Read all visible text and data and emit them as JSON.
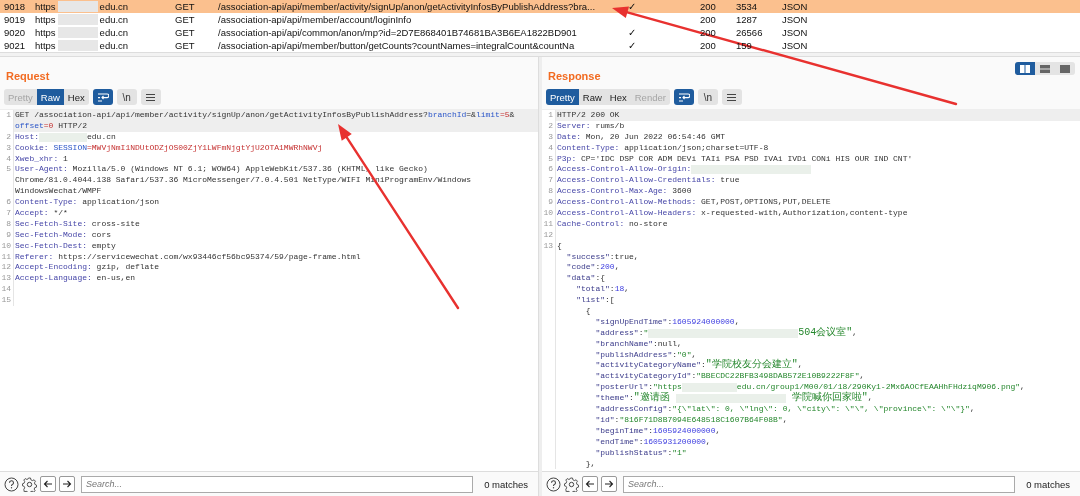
{
  "history": {
    "rows": [
      {
        "number": "9018",
        "scheme": "https",
        "domain": "edu.cn",
        "method": "GET",
        "url": "/association-api/api/member/activity/signUp/anon/getActivityInfosByPublishAddress?bra...",
        "column_5": "✓",
        "status": "200",
        "length": "3534",
        "mime": "JSON",
        "selected": true
      },
      {
        "number": "9019",
        "scheme": "https",
        "domain": "edu.cn",
        "method": "GET",
        "url": "/association-api/api/member/account/loginInfo",
        "status": "200",
        "length": "1287",
        "mime": "JSON",
        "selected": false
      },
      {
        "number": "9020",
        "scheme": "https",
        "domain": "edu.cn",
        "method": "GET",
        "url": "/association-api/api/common/anon/mp?id=2D7E868401B74681BA3B6EA1822BD901",
        "column_5": "✓",
        "status": "200",
        "length": "26566",
        "mime": "JSON",
        "selected": false
      },
      {
        "number": "9021",
        "scheme": "https",
        "domain": "edu.cn",
        "method": "GET",
        "url": "/association-api/api/member/button/getCounts?countNames=integralCount&countNa",
        "column_5": "✓",
        "status": "200",
        "length": "159",
        "mime": "JSON",
        "selected": false
      }
    ]
  },
  "layout_toggle": [
    {
      "selected": true
    },
    {
      "selected": false
    },
    {
      "selected": false
    }
  ],
  "panes": [
    {
      "title": "Request",
      "view_tabs": [
        {
          "label": "Pretty",
          "selected": false,
          "disabled": true
        },
        {
          "label": "Raw",
          "selected": true,
          "disabled": false
        },
        {
          "label": "Hex",
          "selected": false,
          "disabled": false
        }
      ],
      "wrap_lines": {
        "on": true
      },
      "newline_button": "\\n",
      "lines": [
        {
          "n": "1",
          "highlighted": true,
          "segs": [
            {
              "kind": "plain",
              "text": "GET /association-api/api/member/activity/signUp/anon/getActivityInfosByPublishAddress?"
            },
            {
              "kind": "param",
              "text": "branchId"
            },
            {
              "kind": "plain",
              "text": "=&"
            },
            {
              "kind": "param",
              "text": "limit"
            },
            {
              "kind": "pval",
              "text": "=5"
            },
            {
              "kind": "plain",
              "text": "&"
            }
          ]
        },
        {
          "highlighted": true,
          "segs": [
            {
              "kind": "param",
              "text": "offset"
            },
            {
              "kind": "pval",
              "text": "=0"
            },
            {
              "kind": "plain",
              "text": " HTTP/2"
            }
          ]
        },
        {
          "n": "2",
          "highlighted": false,
          "segs": [
            {
              "kind": "name",
              "text": "Host:"
            },
            {
              "kind": "blur"
            },
            {
              "kind": "plain",
              "text": "edu.cn"
            }
          ]
        },
        {
          "n": "3",
          "highlighted": false,
          "segs": [
            {
              "kind": "name",
              "text": "Cookie:"
            },
            {
              "kind": "param",
              "text": " SESSION"
            },
            {
              "kind": "pval",
              "text": "=MWVjNmI1NDUtODZjOS00ZjY1LWFmNjgtYjU2OTA1MWRhNWVj"
            }
          ]
        },
        {
          "n": "4",
          "highlighted": false,
          "segs": [
            {
              "kind": "name",
              "text": "Xweb_xhr:"
            },
            {
              "kind": "plain",
              "text": " 1"
            }
          ]
        },
        {
          "n": "5",
          "highlighted": false,
          "segs": [
            {
              "kind": "name",
              "text": "User-Agent:"
            },
            {
              "kind": "plain",
              "text": " Mozilla/5.0 (Windows NT 6.1; WOW64) AppleWebKit/537.36 (KHTML, like Gecko)"
            }
          ]
        },
        {
          "highlighted": false,
          "segs": [
            {
              "kind": "plain",
              "text": "Chrome/81.0.4044.138 Safari/537.36 MicroMessenger/7.0.4.501 NetType/WIFI MiniProgramEnv/Windows"
            }
          ]
        },
        {
          "highlighted": false,
          "segs": [
            {
              "kind": "plain",
              "text": "WindowsWechat/WMPF"
            }
          ]
        },
        {
          "n": "6",
          "highlighted": false,
          "segs": [
            {
              "kind": "name",
              "text": "Content-Type:"
            },
            {
              "kind": "plain",
              "text": " application/json"
            }
          ]
        },
        {
          "n": "7",
          "highlighted": false,
          "segs": [
            {
              "kind": "name",
              "text": "Accept:"
            },
            {
              "kind": "plain",
              "text": " */*"
            }
          ]
        },
        {
          "n": "8",
          "highlighted": false,
          "segs": [
            {
              "kind": "name",
              "text": "Sec-Fetch-Site:"
            },
            {
              "kind": "plain",
              "text": " cross-site"
            }
          ]
        },
        {
          "n": "9",
          "highlighted": false,
          "segs": [
            {
              "kind": "name",
              "text": "Sec-Fetch-Mode:"
            },
            {
              "kind": "plain",
              "text": " cors"
            }
          ]
        },
        {
          "n": "10",
          "highlighted": false,
          "segs": [
            {
              "kind": "name",
              "text": "Sec-Fetch-Dest:"
            },
            {
              "kind": "plain",
              "text": " empty"
            }
          ]
        },
        {
          "n": "11",
          "highlighted": false,
          "segs": [
            {
              "kind": "name",
              "text": "Referer:"
            },
            {
              "kind": "plain",
              "text": " https://servicewechat.com/wx93446cf56bc95374/59/page-frame.html"
            }
          ]
        },
        {
          "n": "12",
          "highlighted": false,
          "segs": [
            {
              "kind": "name",
              "text": "Accept-Encoding:"
            },
            {
              "kind": "plain",
              "text": " gzip, deflate"
            }
          ]
        },
        {
          "n": "13",
          "highlighted": false,
          "segs": [
            {
              "kind": "name",
              "text": "Accept-Language:"
            },
            {
              "kind": "plain",
              "text": " en-us,en"
            }
          ]
        },
        {
          "n": "14",
          "highlighted": false
        },
        {
          "n": "15",
          "highlighted": false
        }
      ],
      "search": {
        "placeholder": "Search...",
        "matches": "0 matches"
      }
    },
    {
      "title": "Response",
      "view_tabs": [
        {
          "label": "Pretty",
          "selected": true,
          "disabled": false
        },
        {
          "label": "Raw",
          "selected": false,
          "disabled": false
        },
        {
          "label": "Hex",
          "selected": false,
          "disabled": false
        },
        {
          "label": "Render",
          "selected": false,
          "disabled": true
        }
      ],
      "wrap_lines": {
        "on": true
      },
      "newline_button": "\\n",
      "lines": [
        {
          "n": "1",
          "highlighted": true,
          "segs": [
            {
              "kind": "plain",
              "text": "HTTP/2 200 OK"
            }
          ]
        },
        {
          "n": "2",
          "highlighted": false,
          "segs": [
            {
              "kind": "name",
              "text": "Server:"
            },
            {
              "kind": "plain",
              "text": " rums/b"
            }
          ]
        },
        {
          "n": "3",
          "highlighted": false,
          "segs": [
            {
              "kind": "name",
              "text": "Date:"
            },
            {
              "kind": "plain",
              "text": " Mon, 20 Jun 2022 06:54:46 GMT"
            }
          ]
        },
        {
          "n": "4",
          "highlighted": false,
          "segs": [
            {
              "kind": "name",
              "text": "Content-Type:"
            },
            {
              "kind": "plain",
              "text": " application/json;charset=UTF-8"
            }
          ]
        },
        {
          "n": "5",
          "highlighted": false,
          "segs": [
            {
              "kind": "name",
              "text": "P3p:"
            },
            {
              "kind": "plain",
              "text": " CP='IDC DSP COR ADM DEVi TAIi PSA PSD IVAi IVDi CONi HIS OUR IND CNT'"
            }
          ]
        },
        {
          "n": "6",
          "highlighted": false,
          "segs": [
            {
              "kind": "name",
              "text": "Access-Control-Allow-Origin:"
            },
            {
              "kind": "blur"
            }
          ]
        },
        {
          "n": "7",
          "highlighted": false,
          "segs": [
            {
              "kind": "name",
              "text": "Access-Control-Allow-Credentials:"
            },
            {
              "kind": "plain",
              "text": " true"
            }
          ]
        },
        {
          "n": "8",
          "highlighted": false,
          "segs": [
            {
              "kind": "name",
              "text": "Access-Control-Max-Age:"
            },
            {
              "kind": "plain",
              "text": " 3600"
            }
          ]
        },
        {
          "n": "9",
          "highlighted": false,
          "segs": [
            {
              "kind": "name",
              "text": "Access-Control-Allow-Methods:"
            },
            {
              "kind": "plain",
              "text": " GET,POST,OPTIONS,PUT,DELETE"
            }
          ]
        },
        {
          "n": "10",
          "highlighted": false,
          "segs": [
            {
              "kind": "name",
              "text": "Access-Control-Allow-Headers:"
            },
            {
              "kind": "plain",
              "text": " x-requested-with,Authorization,content-type"
            }
          ]
        },
        {
          "n": "11",
          "highlighted": false,
          "segs": [
            {
              "kind": "name",
              "text": "Cache-Control:"
            },
            {
              "kind": "plain",
              "text": " no-store"
            }
          ]
        },
        {
          "n": "12",
          "highlighted": false
        },
        {
          "n": "13",
          "highlighted": false,
          "segs": [
            {
              "kind": "plain",
              "text": "{"
            }
          ]
        },
        {
          "highlighted": false,
          "segs": [
            {
              "kind": "key",
              "text": "  \"success\""
            },
            {
              "kind": "plain",
              "text": ":true,"
            }
          ]
        },
        {
          "highlighted": false,
          "segs": [
            {
              "kind": "key",
              "text": "  \"code\""
            },
            {
              "kind": "plain",
              "text": ":"
            },
            {
              "kind": "num",
              "text": "200"
            },
            {
              "kind": "plain",
              "text": ","
            }
          ]
        },
        {
          "highlighted": false,
          "segs": [
            {
              "kind": "key",
              "text": "  \"data\""
            },
            {
              "kind": "plain",
              "text": ":{"
            }
          ]
        },
        {
          "highlighted": false,
          "segs": [
            {
              "kind": "key",
              "text": "    \"total\""
            },
            {
              "kind": "plain",
              "text": ":"
            },
            {
              "kind": "num",
              "text": "18"
            },
            {
              "kind": "plain",
              "text": ","
            }
          ]
        },
        {
          "highlighted": false,
          "segs": [
            {
              "kind": "key",
              "text": "    \"list\""
            },
            {
              "kind": "plain",
              "text": ":["
            }
          ]
        },
        {
          "highlighted": false,
          "segs": [
            {
              "kind": "plain",
              "text": "      {"
            }
          ]
        },
        {
          "highlighted": false,
          "segs": [
            {
              "kind": "key",
              "text": "        \"signUpEndTime\""
            },
            {
              "kind": "plain",
              "text": ":"
            },
            {
              "kind": "num",
              "text": "1605924000000"
            },
            {
              "kind": "plain",
              "text": ","
            }
          ]
        },
        {
          "highlighted": false,
          "segs": [
            {
              "kind": "key",
              "text": "        \"address\""
            },
            {
              "kind": "plain",
              "text": ":"
            },
            {
              "kind": "str",
              "text": "\""
            },
            {
              "kind": "blur"
            },
            {
              "kind": "str",
              "text": "504会议室\""
            },
            {
              "kind": "plain",
              "text": ","
            }
          ]
        },
        {
          "highlighted": false,
          "segs": [
            {
              "kind": "key",
              "text": "        \"branchName\""
            },
            {
              "kind": "plain",
              "text": ":null,"
            }
          ]
        },
        {
          "highlighted": false,
          "segs": [
            {
              "kind": "key",
              "text": "        \"publishAddress\""
            },
            {
              "kind": "plain",
              "text": ":"
            },
            {
              "kind": "str",
              "text": "\"0\""
            },
            {
              "kind": "plain",
              "text": ","
            }
          ]
        },
        {
          "highlighted": false,
          "segs": [
            {
              "kind": "key",
              "text": "        \"activityCategoryName\""
            },
            {
              "kind": "plain",
              "text": ":"
            },
            {
              "kind": "str",
              "text": "\"学院校友分会建立\""
            },
            {
              "kind": "plain",
              "text": ","
            }
          ]
        },
        {
          "highlighted": false,
          "segs": [
            {
              "kind": "key",
              "text": "        \"activityCategoryId\""
            },
            {
              "kind": "plain",
              "text": ":"
            },
            {
              "kind": "str",
              "text": "\"BBECDC22BFB3498DAB572E10B9222F8F\""
            },
            {
              "kind": "plain",
              "text": ","
            }
          ]
        },
        {
          "highlighted": false,
          "segs": [
            {
              "kind": "key",
              "text": "        \"posterUrl\""
            },
            {
              "kind": "plain",
              "text": ":"
            },
            {
              "kind": "str",
              "text": "\"https"
            },
            {
              "kind": "blur"
            },
            {
              "kind": "str",
              "text": "edu.cn/group1/M00/01/18/290Ky1-2Mx6AOCfEAAHhFHdziqM906.png\""
            },
            {
              "kind": "plain",
              "text": ","
            }
          ]
        },
        {
          "highlighted": false,
          "segs": [
            {
              "kind": "key",
              "text": "        \"theme\""
            },
            {
              "kind": "plain",
              "text": ":"
            },
            {
              "kind": "str",
              "text": "\"邀请函 "
            },
            {
              "kind": "blur"
            },
            {
              "kind": "str",
              "text": " 学院喊你回家啦\""
            },
            {
              "kind": "plain",
              "text": ","
            }
          ]
        },
        {
          "highlighted": false,
          "segs": [
            {
              "kind": "key",
              "text": "        \"addressConfig\""
            },
            {
              "kind": "plain",
              "text": ":"
            },
            {
              "kind": "str",
              "text": "\"{\\\"lat\\\": 0, \\\"lng\\\": 0, \\\"city\\\": \\\"\\\", \\\"province\\\": \\\"\\\"}\""
            },
            {
              "kind": "plain",
              "text": ","
            }
          ]
        },
        {
          "highlighted": false,
          "segs": [
            {
              "kind": "key",
              "text": "        \"id\""
            },
            {
              "kind": "plain",
              "text": ":"
            },
            {
              "kind": "str",
              "text": "\"816F71D8B7094E648518C1607B64F08B\""
            },
            {
              "kind": "plain",
              "text": ","
            }
          ]
        },
        {
          "highlighted": false,
          "segs": [
            {
              "kind": "key",
              "text": "        \"beginTime\""
            },
            {
              "kind": "plain",
              "text": ":"
            },
            {
              "kind": "num",
              "text": "1605924000000"
            },
            {
              "kind": "plain",
              "text": ","
            }
          ]
        },
        {
          "highlighted": false,
          "segs": [
            {
              "kind": "key",
              "text": "        \"endTime\""
            },
            {
              "kind": "plain",
              "text": ":"
            },
            {
              "kind": "num",
              "text": "1605931200000"
            },
            {
              "kind": "plain",
              "text": ","
            }
          ]
        },
        {
          "highlighted": false,
          "segs": [
            {
              "kind": "key",
              "text": "        \"publishStatus\""
            },
            {
              "kind": "plain",
              "text": ":"
            },
            {
              "kind": "str",
              "text": "\"1\""
            }
          ]
        },
        {
          "highlighted": false,
          "segs": [
            {
              "kind": "plain",
              "text": "      },"
            }
          ]
        }
      ],
      "search": {
        "placeholder": "Search...",
        "matches": "0 matches"
      }
    }
  ],
  "annotations": [
    {
      "kind": "arrow"
    },
    {
      "kind": "arrow"
    }
  ]
}
